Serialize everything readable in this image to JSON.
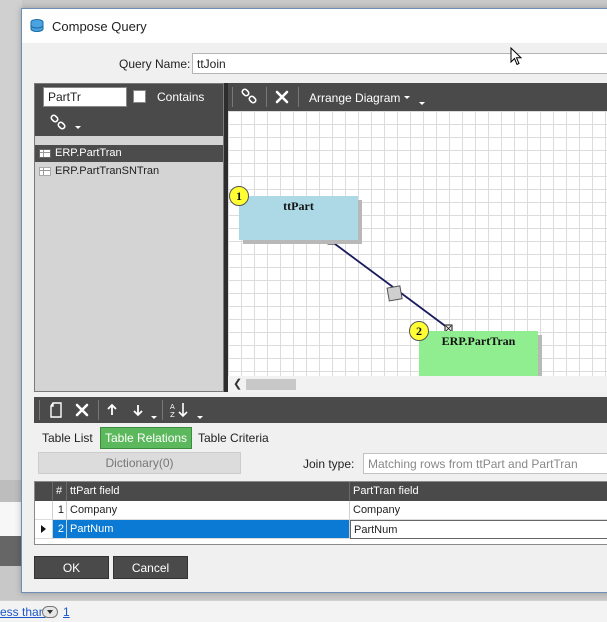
{
  "window": {
    "title": "Compose Query"
  },
  "query": {
    "name_label": "Query Name:",
    "name_value": "ttJoin"
  },
  "table_browser": {
    "filter_value": "PartTr",
    "contains_label": "Contains",
    "contains_checked": false,
    "tables": [
      {
        "label": "ERP.PartTran",
        "selected": true
      },
      {
        "label": "ERP.PartTranSNTran",
        "selected": false
      }
    ]
  },
  "diagram": {
    "toolbar": {
      "arrange_label": "Arrange Diagram"
    },
    "tables": [
      {
        "order": "1",
        "name": "ttPart",
        "color": "#add8e6"
      },
      {
        "order": "2",
        "name": "ERP.PartTran",
        "color": "#90ee90"
      }
    ],
    "relation_color": "#1a1a5e"
  },
  "tabs": [
    {
      "label": "Table List",
      "active": false
    },
    {
      "label": "Table Relations",
      "active": true
    },
    {
      "label": "Table Criteria",
      "active": false
    }
  ],
  "relations": {
    "dictionary_label": "Dictionary(0)",
    "join_type_label": "Join type:",
    "join_type_value": "Matching rows from ttPart and PartTran",
    "grid": {
      "columns": [
        "#",
        "ttPart field",
        "PartTran field"
      ],
      "rows": [
        {
          "num": "1",
          "left_field": "Company",
          "right_field": "Company",
          "selected": false
        },
        {
          "num": "2",
          "left_field": "PartNum",
          "right_field": "PartNum",
          "selected": true
        }
      ]
    }
  },
  "buttons": {
    "ok": "OK",
    "cancel": "Cancel"
  },
  "background": {
    "link_text": "ess than",
    "page_link": "1"
  },
  "colors": {
    "toolbar_dark": "#4a4a4a",
    "active_tab": "#5cb85c",
    "selection_blue": "#0a7ad4"
  }
}
